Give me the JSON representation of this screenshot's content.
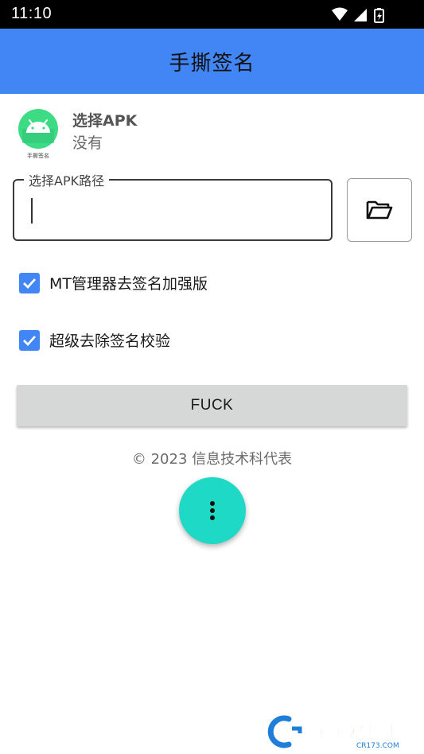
{
  "status_bar": {
    "time": "11:10",
    "icons": [
      "wifi-icon",
      "signal-icon",
      "battery-charging-icon"
    ]
  },
  "app_bar": {
    "title": "手撕签名"
  },
  "apk": {
    "icon_caption": "手撕签名",
    "title": "选择APK",
    "subtitle": "没有"
  },
  "path_field": {
    "label": "选择APK路径",
    "value": ""
  },
  "options": [
    {
      "label": "MT管理器去签名加强版",
      "checked": true
    },
    {
      "label": "超级去除签名校验",
      "checked": true
    }
  ],
  "main_button": {
    "label": "FUCK"
  },
  "footer": {
    "copyright": "© 2023 信息技术科代表"
  },
  "fab": {
    "icon": "more-vert-icon"
  },
  "watermark": {
    "text": "西西软件园",
    "url_text": "CR173.COM"
  },
  "colors": {
    "app_bar": "#4285f4",
    "checkbox": "#4285f4",
    "fab": "#1dd9c6",
    "button": "#d6d7d7",
    "android_green": "#3ddc84"
  }
}
